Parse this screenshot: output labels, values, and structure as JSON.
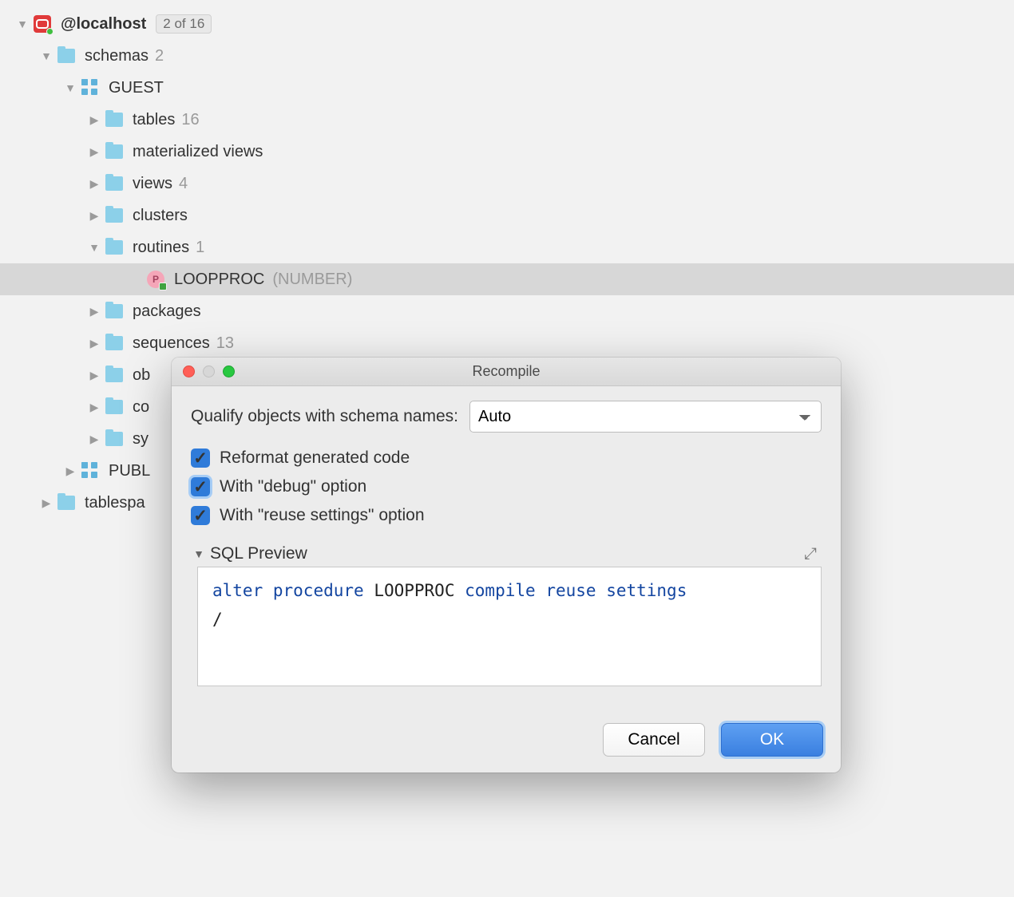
{
  "tree": {
    "root": {
      "label": "@localhost",
      "badge": "2 of 16"
    },
    "schemas": {
      "label": "schemas",
      "count": "2"
    },
    "guest": {
      "label": "GUEST"
    },
    "tables": {
      "label": "tables",
      "count": "16"
    },
    "matviews": {
      "label": "materialized views"
    },
    "views": {
      "label": "views",
      "count": "4"
    },
    "clusters": {
      "label": "clusters"
    },
    "routines": {
      "label": "routines",
      "count": "1"
    },
    "loopproc": {
      "label": "LOOPPROC",
      "type": "(NUMBER)",
      "icon_letter": "P"
    },
    "packages": {
      "label": "packages"
    },
    "sequences": {
      "label": "sequences",
      "count": "13"
    },
    "objtypes": {
      "label": "ob"
    },
    "collections": {
      "label": "co"
    },
    "synonyms": {
      "label": "sy"
    },
    "public": {
      "label": "PUBL"
    },
    "tablespaces": {
      "label": "tablespa"
    }
  },
  "dialog": {
    "title": "Recompile",
    "qualify_label": "Qualify objects with schema names:",
    "qualify_value": "Auto",
    "cb_reformat": "Reformat generated code",
    "cb_debug": "With \"debug\" option",
    "cb_reuse": "With \"reuse settings\" option",
    "preview_label": "SQL Preview",
    "sql_tokens": {
      "alter": "alter",
      "procedure": "procedure",
      "name": "LOOPPROC",
      "compile": "compile",
      "reuse": "reuse",
      "settings": "settings",
      "slash": "/"
    },
    "btn_cancel": "Cancel",
    "btn_ok": "OK"
  }
}
